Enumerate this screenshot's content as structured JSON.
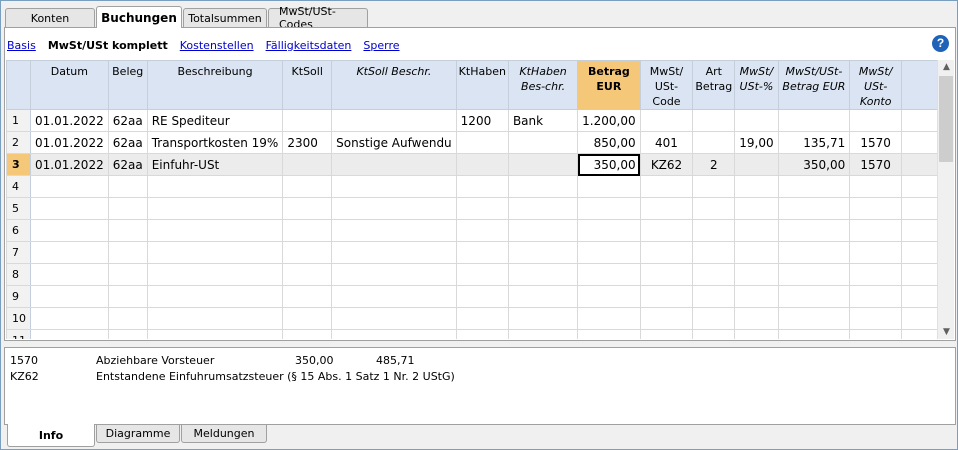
{
  "top_tabs": [
    "Konten",
    "Buchungen",
    "Totalsummen",
    "MwSt/USt-Codes"
  ],
  "active_top_tab": "Buchungen",
  "views": [
    "Basis",
    "MwSt/USt komplett",
    "Kostenstellen",
    "Fälligkeitsdaten",
    "Sperre"
  ],
  "active_view": "MwSt/USt komplett",
  "help_icon": "help-icon",
  "columns": [
    {
      "label": "",
      "style": "normal"
    },
    {
      "label": "Datum",
      "style": "normal"
    },
    {
      "label": "Beleg",
      "style": "normal"
    },
    {
      "label": "Beschreibung",
      "style": "normal"
    },
    {
      "label": "KtSoll",
      "style": "normal"
    },
    {
      "label": "KtSoll Beschr.",
      "style": "italic"
    },
    {
      "label": "KtHaben",
      "style": "normal"
    },
    {
      "label": "KtHaben Bes-chr.",
      "style": "italic"
    },
    {
      "label": "Betrag EUR",
      "style": "highlight"
    },
    {
      "label": "MwSt/ USt-Code",
      "style": "normal"
    },
    {
      "label": "Art Betrag",
      "style": "normal"
    },
    {
      "label": "MwSt/ USt-%",
      "style": "italic"
    },
    {
      "label": "MwSt/USt-Betrag EUR",
      "style": "italic"
    },
    {
      "label": "MwSt/ USt-Konto",
      "style": "italic"
    },
    {
      "label": "",
      "style": "empty"
    }
  ],
  "rows": [
    [
      "1",
      "01.01.2022",
      "62aa",
      "RE Spediteur",
      "",
      "",
      "1200",
      "Bank",
      "1.200,00",
      "",
      "",
      "",
      "",
      "",
      ""
    ],
    [
      "2",
      "01.01.2022",
      "62aa",
      "Transportkosten 19%",
      "2300",
      "Sonstige Aufwendu",
      "",
      "",
      "850,00",
      "401",
      "",
      "19,00",
      "135,71",
      "1570",
      ""
    ],
    [
      "3",
      "01.01.2022",
      "62aa",
      "Einfuhr-USt",
      "",
      "",
      "",
      "",
      "350,00",
      "KZ62",
      "2",
      "",
      "350,00",
      "1570",
      ""
    ],
    [
      "4",
      "",
      "",
      "",
      "",
      "",
      "",
      "",
      "",
      "",
      "",
      "",
      "",
      "",
      ""
    ],
    [
      "5",
      "",
      "",
      "",
      "",
      "",
      "",
      "",
      "",
      "",
      "",
      "",
      "",
      "",
      ""
    ],
    [
      "6",
      "",
      "",
      "",
      "",
      "",
      "",
      "",
      "",
      "",
      "",
      "",
      "",
      "",
      ""
    ],
    [
      "7",
      "",
      "",
      "",
      "",
      "",
      "",
      "",
      "",
      "",
      "",
      "",
      "",
      "",
      ""
    ],
    [
      "8",
      "",
      "",
      "",
      "",
      "",
      "",
      "",
      "",
      "",
      "",
      "",
      "",
      "",
      ""
    ],
    [
      "9",
      "",
      "",
      "",
      "",
      "",
      "",
      "",
      "",
      "",
      "",
      "",
      "",
      "",
      ""
    ],
    [
      "10",
      "",
      "",
      "",
      "",
      "",
      "",
      "",
      "",
      "",
      "",
      "",
      "",
      "",
      ""
    ],
    [
      "11",
      "",
      "",
      "",
      "",
      "",
      "",
      "",
      "",
      "",
      "",
      "",
      "",
      "",
      ""
    ]
  ],
  "current_row": 3,
  "info_lines": [
    {
      "code": "1570",
      "text": "Abziehbare Vorsteuer",
      "amount1": "350,00",
      "amount2": "485,71"
    },
    {
      "code": "KZ62",
      "text": "Entstandene Einfuhrumsatzsteuer (§ 15 Abs. 1 Satz 1 Nr. 2 UStG)",
      "amount1": "",
      "amount2": ""
    }
  ],
  "bottom_tabs": [
    "Info",
    "Diagramme",
    "Meldungen"
  ],
  "active_bottom_tab": "Info",
  "colors": {
    "header_bg": "#dae4f2",
    "highlight": "#f5c879",
    "link": "#0000cc",
    "help": "#1e63b8"
  }
}
